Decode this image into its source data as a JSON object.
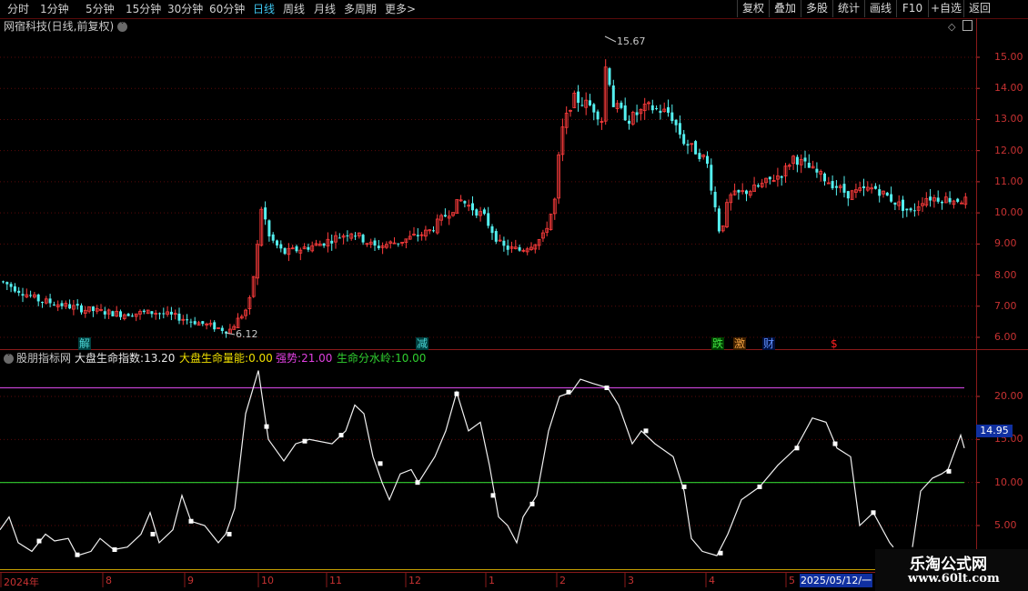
{
  "toolbar": {
    "periods": [
      "分时",
      "1分钟",
      "5分钟",
      "15分钟",
      "30分钟",
      "60分钟",
      "日线",
      "周线",
      "月线",
      "多周期",
      "更多"
    ],
    "active_period": "日线",
    "more_arrow": ">",
    "right_buttons": [
      "复权",
      "叠加",
      "多股",
      "统计",
      "画线",
      "F10",
      "+自选",
      "返回"
    ]
  },
  "main_panel": {
    "title": "网宿科技(日线,前复权)",
    "y_ticks": [
      "15.00",
      "14.00",
      "13.00",
      "12.00",
      "11.00",
      "10.00",
      "9.00",
      "8.00",
      "7.00",
      "6.00"
    ],
    "high_label": "15.67",
    "low_label": "6.12",
    "event_markers": [
      {
        "text": "解",
        "color": "#ff4040"
      },
      {
        "text": "减",
        "color": "#ff4040"
      },
      {
        "text": "跌",
        "color": "#ff4040"
      },
      {
        "text": "激",
        "color": "#ff4040"
      },
      {
        "text": "财",
        "color": "#ff4040"
      },
      {
        "text": "$",
        "color": "#ff2020"
      }
    ]
  },
  "indicator_panel": {
    "name": "股朋指标网",
    "items": [
      {
        "label": "大盘生命指数",
        "value": "13.20",
        "color": "#e8e8e8"
      },
      {
        "label": "大盘生命量能",
        "value": "0.00",
        "color": "#f0e000"
      },
      {
        "label": "强势",
        "value": "21.00",
        "color": "#e040e0"
      },
      {
        "label": "生命分水岭",
        "value": "10.00",
        "color": "#30d030"
      }
    ],
    "y_ticks": [
      "20.00",
      "15.00",
      "10.00",
      "5.00"
    ],
    "current_value": "14.95"
  },
  "time_axis": {
    "labels": [
      "2024年",
      "8",
      "9",
      "10",
      "11",
      "12",
      "1",
      "2",
      "3",
      "4",
      "5"
    ],
    "date_box": "2025/05/12/一"
  },
  "watermark": {
    "line1": "乐淘公式网",
    "line2": "www.60lt.com"
  },
  "colors": {
    "up": "#ff3c3c",
    "down": "#54f0f0",
    "grid": "#5a0a0a",
    "axis": "#c83232",
    "upper_line": "#c040d0",
    "lower_line": "#30d030"
  }
}
